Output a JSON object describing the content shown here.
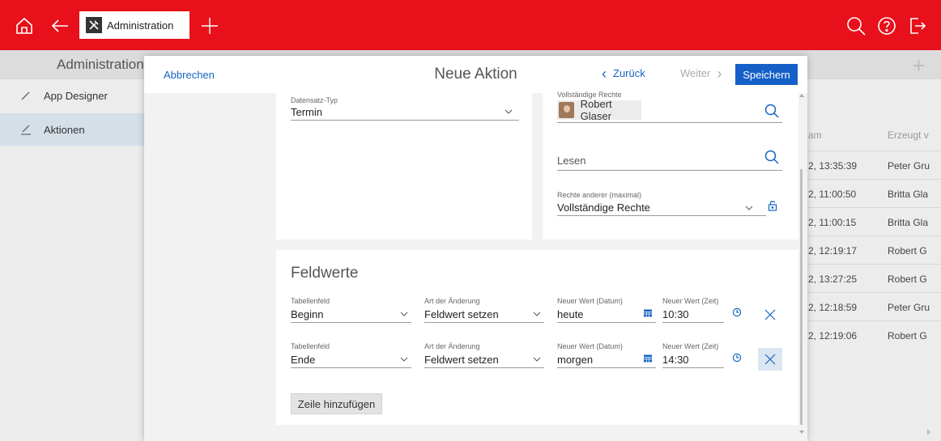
{
  "topbar": {
    "tab_label": "Administration"
  },
  "background": {
    "title": "Administration",
    "sidebar": {
      "items": [
        {
          "label": "App Designer"
        },
        {
          "label": "Aktionen"
        }
      ]
    },
    "table": {
      "headers": [
        "am",
        "Erzeugt v"
      ],
      "rows": [
        [
          "2, 13:35:39",
          "Peter Gru"
        ],
        [
          "2, 11:00:50",
          "Britta Gla"
        ],
        [
          "2, 11:00:15",
          "Britta Gla"
        ],
        [
          "2, 12:19:17",
          "Robert G"
        ],
        [
          "2, 13:27:25",
          "Robert G"
        ],
        [
          "2, 12:18:59",
          "Peter Gru"
        ],
        [
          "2, 12:19:06",
          "Robert G"
        ]
      ]
    }
  },
  "modal": {
    "cancel_label": "Abbrechen",
    "title": "Neue Aktion",
    "back_label": "Zurück",
    "next_label": "Weiter",
    "save_label": "Speichern",
    "record_type": {
      "label": "Datensatz-Typ",
      "value": "Termin"
    },
    "full_rights": {
      "label": "Vollständige Rechte",
      "user": "Robert Glaser"
    },
    "read": {
      "placeholder": "Lesen"
    },
    "others_rights": {
      "label": "Rechte anderer (maximal)",
      "value": "Vollständige Rechte"
    },
    "field_values": {
      "title": "Feldwerte",
      "rows": [
        {
          "field_label": "Tabellenfeld",
          "field_value": "Beginn",
          "change_label": "Art der Änderung",
          "change_value": "Feldwert setzen",
          "date_label": "Neuer Wert (Datum)",
          "date_value": "heute",
          "time_label": "Neuer Wert (Zeit)",
          "time_value": "10:30"
        },
        {
          "field_label": "Tabellenfeld",
          "field_value": "Ende",
          "change_label": "Art der Änderung",
          "change_value": "Feldwert setzen",
          "date_label": "Neuer Wert (Datum)",
          "date_value": "morgen",
          "time_label": "Neuer Wert (Zeit)",
          "time_value": "14:30"
        }
      ],
      "add_row_label": "Zeile hinzufügen"
    }
  },
  "colors": {
    "brand_red": "#e8101b",
    "accent_blue": "#1560c8"
  }
}
